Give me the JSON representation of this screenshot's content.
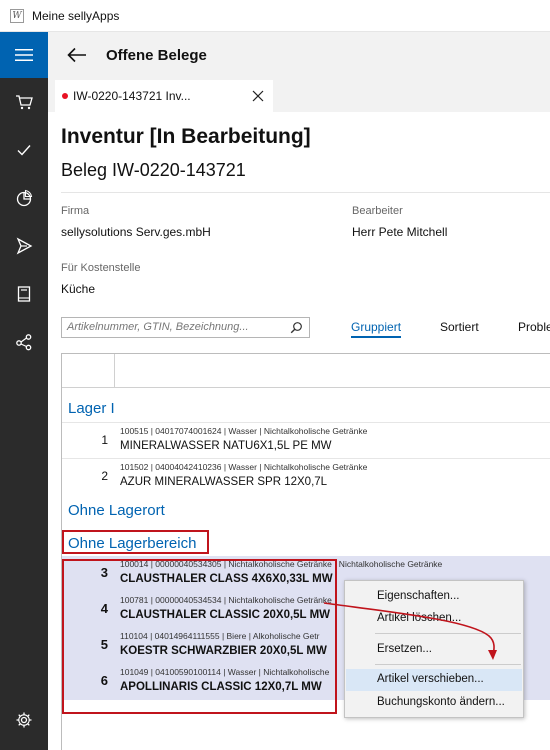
{
  "window": {
    "title": "Meine sellyApps"
  },
  "header": {
    "title": "Offene Belege"
  },
  "tab": {
    "label": "IW-0220-143721 Inv..."
  },
  "document": {
    "title": "Inventur [In Bearbeitung]",
    "subtitle": "Beleg IW-0220-143721",
    "firma_label": "Firma",
    "firma_value": "sellysolutions Serv.ges.mbH",
    "bearbeiter_label": "Bearbeiter",
    "bearbeiter_value": "Herr Pete Mitchell",
    "kostenstelle_label": "Für Kostenstelle",
    "kostenstelle_value": "Küche"
  },
  "search": {
    "placeholder": "Artikelnummer, GTIN, Bezeichnung..."
  },
  "filters": {
    "gruppiert": "Gruppiert",
    "sortiert": "Sortiert",
    "probleme": "Proble"
  },
  "groups": {
    "lager1": "Lager I",
    "ohne_lagerort": "Ohne Lagerort",
    "ohne_lagerbereich": "Ohne Lagerbereich"
  },
  "rows": [
    {
      "num": "1",
      "meta": "100515 | 04017074001624 | Wasser | Nichtalkoholische Getränke",
      "name": "MINERALWASSER NATU6X1,5L PE MW"
    },
    {
      "num": "2",
      "meta": "101502 | 04004042410236 | Wasser | Nichtalkoholische Getränke",
      "name": "AZUR MINERALWASSER SPR 12X0,7L"
    },
    {
      "num": "3",
      "meta": "100014 | 00000040534305 | Nichtalkoholische Getränke | Nichtalkoholische Getränke",
      "name": "CLAUSTHALER CLASS 4X6X0,33L MW"
    },
    {
      "num": "4",
      "meta": "100781 | 00000040534534 | Nichtalkoholische Getränke",
      "name": "CLAUSTHALER CLASSIC 20X0,5L MW"
    },
    {
      "num": "5",
      "meta": "110104 | 04014964111555 | Biere | Alkoholische Getr",
      "name": "KOESTR SCHWARZBIER 20X0,5L MW"
    },
    {
      "num": "6",
      "meta": "101049 | 04100590100114 | Wasser | Nichtalkoholische",
      "name": "APOLLINARIS CLASSIC 12X0,7L MW"
    }
  ],
  "context_menu": {
    "eigenschaften": "Eigenschaften...",
    "loeschen": "Artikel löschen...",
    "ersetzen": "Ersetzen...",
    "verschieben": "Artikel verschieben...",
    "buchungskonto": "Buchungskonto ändern..."
  },
  "icons": {
    "menu": "hamburger-icon",
    "cart": "cart-icon",
    "check": "checkmark-icon",
    "chart": "pie-chart-icon",
    "send": "send-icon",
    "book": "book-icon",
    "share": "share-icon",
    "settings": "gear-icon"
  },
  "colors": {
    "accent": "#0063b1",
    "sidebar": "#2b2b2b",
    "highlight_box": "#c0141c",
    "selection": "#dfe1f2",
    "tab_dot": "#e81123"
  }
}
